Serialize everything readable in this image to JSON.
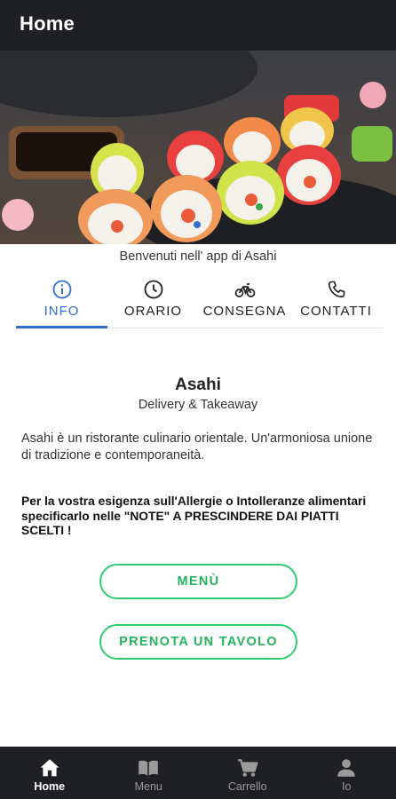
{
  "appbar": {
    "title": "Home"
  },
  "welcome": "Benvenuti nell' app di Asahi",
  "tabs": [
    {
      "label": "INFO",
      "icon": "info-icon",
      "active": true
    },
    {
      "label": "ORARIO",
      "icon": "clock-icon",
      "active": false
    },
    {
      "label": "CONSEGNA",
      "icon": "bicycle-icon",
      "active": false
    },
    {
      "label": "CONTATTI",
      "icon": "phone-icon",
      "active": false
    }
  ],
  "info": {
    "name": "Asahi",
    "subtitle": "Delivery & Takeaway",
    "description": "Asahi è un ristorante culinario orientale. Un'armoniosa unione di tradizione e contemporaneità.",
    "notice": "Per la vostra esigenza sull'Allergie o Intolleranze alimentari specificarlo nelle \"NOTE\" A PRESCINDERE DAI PIATTI SCELTI !"
  },
  "buttons": {
    "menu": "MENÙ",
    "book": "PRENOTA UN TAVOLO"
  },
  "bottom_nav": [
    {
      "label": "Home",
      "icon": "home-icon",
      "active": true
    },
    {
      "label": "Menu",
      "icon": "book-icon",
      "active": false
    },
    {
      "label": "Carrello",
      "icon": "cart-icon",
      "active": false
    },
    {
      "label": "Io",
      "icon": "person-icon",
      "active": false
    }
  ],
  "colors": {
    "accent_blue": "#2c6fcf",
    "accent_green": "#2ecc71",
    "bar_dark": "#1f2023"
  }
}
